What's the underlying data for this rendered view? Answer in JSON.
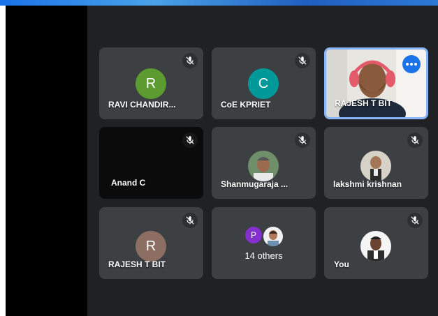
{
  "colors": {
    "background": "#202124",
    "tile": "#3c4043",
    "active_border": "#8ab4f8",
    "avatar_green": "#5c9b2f",
    "avatar_teal": "#00999a",
    "avatar_brown": "#8d6e63",
    "avatar_purple": "#8430ce",
    "more_button": "#1a73e8"
  },
  "participants": [
    {
      "name": "RAVI CHANDIR...",
      "initial": "R",
      "muted": true
    },
    {
      "name": "CoE KPRIET",
      "initial": "C",
      "muted": true
    },
    {
      "name": "RAJESH T BIT",
      "video": true,
      "active": true
    },
    {
      "name": "Anand C",
      "muted": true,
      "video_off": true
    },
    {
      "name": "Shanmugaraja ...",
      "muted": true,
      "photo": true
    },
    {
      "name": "lakshmi krishnan",
      "muted": true,
      "photo": true
    },
    {
      "name": "RAJESH T BIT",
      "initial": "R",
      "muted": true
    },
    {
      "name": "14 others",
      "initial": "P",
      "others": true
    },
    {
      "name": "You",
      "muted": true,
      "photo": true
    }
  ],
  "icons": {
    "mute": "mic-off-icon",
    "more": "more-options-icon"
  }
}
